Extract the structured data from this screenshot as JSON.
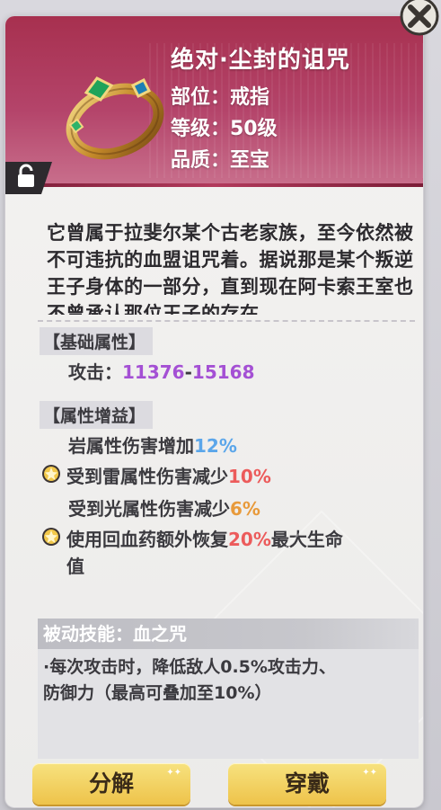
{
  "item": {
    "name": "绝对·尘封的诅咒",
    "slot": "部位：戒指",
    "level": "等级：50级",
    "quality": "品质：至宝",
    "description": "它曾属于拉斐尔某个古老家族，至今依然被不可违抗的血盟诅咒着。据说那是某个叛逆王子身体的一部分，直到现在阿卡索王室也不曾承认那位王子的存在。"
  },
  "base_attr": {
    "header": "【基础属性】",
    "attack_label": "攻击：",
    "attack_min": "11376",
    "attack_sep": "-",
    "attack_max": "15168"
  },
  "bonus": {
    "header": "【属性增益】",
    "rows": [
      {
        "text": "岩属性伤害增加",
        "value": "12%",
        "color": "#5ba6ea",
        "starred": false
      },
      {
        "text": "受到雷属性伤害减少",
        "value": "10%",
        "color": "#ec5b5b",
        "starred": true
      },
      {
        "text": "受到光属性伤害减少",
        "value": "6%",
        "color": "#e89a3b",
        "starred": false
      },
      {
        "text": "使用回血药额外恢复",
        "value": "20%",
        "suffix": "最大生命",
        "line2": "值",
        "color": "#ec5b5b",
        "starred": true
      }
    ]
  },
  "skill": {
    "title": "被动技能：血之咒",
    "desc_line1": "·每次攻击时，降低敌人0.5%攻击力、",
    "desc_line2": "防御力（最高可叠加至10%）"
  },
  "buttons": {
    "decompose": "分解",
    "equip": "穿戴"
  },
  "colors": {
    "header_accent": "#a7304f",
    "button_gold": "#eec34a",
    "attack_purple": "#a450d4"
  }
}
